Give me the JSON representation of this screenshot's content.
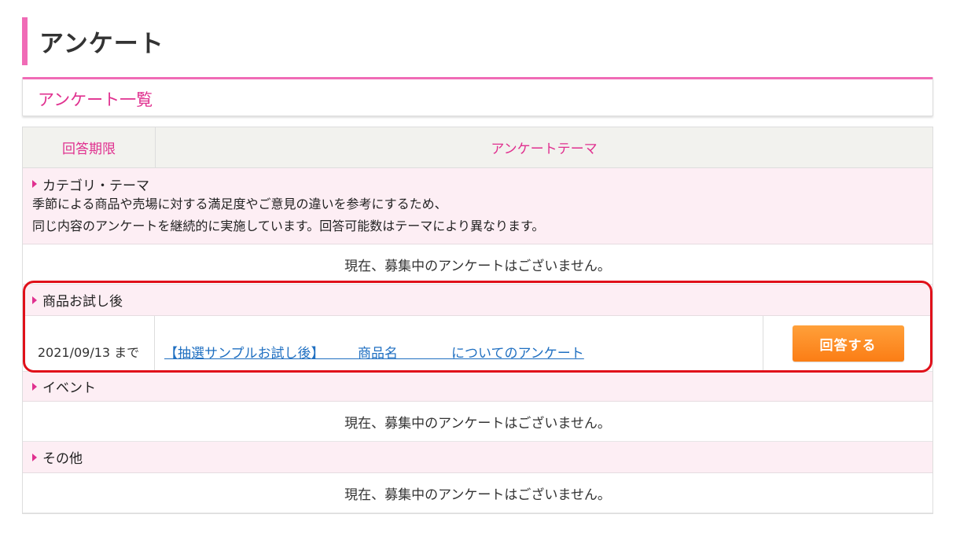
{
  "page": {
    "title": "アンケート"
  },
  "list": {
    "subtitle": "アンケート一覧"
  },
  "table": {
    "headers": {
      "deadline": "回答期限",
      "theme": "アンケートテーマ"
    }
  },
  "categories": [
    {
      "title": "カテゴリ・テーマ",
      "description_lines": [
        "季節による商品や売場に対する満足度やご意見の違いを参考にするため、",
        "同じ内容のアンケートを継続的に実施しています。回答可能数はテーマにより異なります。"
      ],
      "empty_message": "現在、募集中のアンケートはございません。"
    },
    {
      "title": "商品お試し後",
      "item": {
        "deadline": "2021/09/13 まで",
        "link_text": "【抽選サンプルお試し後】　　　商品名　　　　についてのアンケート",
        "button_label": "回答する"
      }
    },
    {
      "title": "イベント",
      "empty_message": "現在、募集中のアンケートはございません。"
    },
    {
      "title": "その他",
      "empty_message": "現在、募集中のアンケートはございません。"
    }
  ],
  "colors": {
    "accent_pink": "#e0308f",
    "heading_bar": "#f06bb6",
    "button_orange": "#fb7d15",
    "highlight_red": "#e0101a",
    "link_blue": "#1f6fc1"
  }
}
